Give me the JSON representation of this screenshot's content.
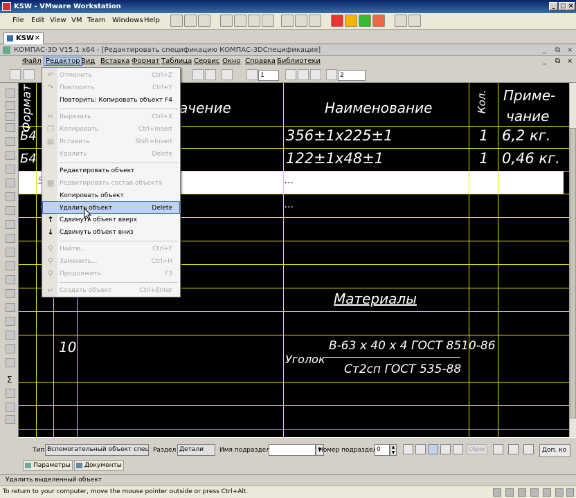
{
  "vm": {
    "title": "KSW - VMware Workstation",
    "menu": [
      "File",
      "Edit",
      "View",
      "VM",
      "Team",
      "Windows",
      "Help"
    ],
    "tab": "KSW",
    "tab_close": "✕",
    "status": "To return to your computer, move the mouse pointer outside or press Ctrl+Alt."
  },
  "kompas": {
    "title": "КОМПАС-3D V15.1 x64 - [Редактировать спецификацию КОМПАС-3DСпецификация]",
    "menu": [
      "Файл",
      "Редактор",
      "Вид",
      "Вставка",
      "Формат",
      "Таблица",
      "Сервис",
      "Окно",
      "Справка",
      "Библиотеки"
    ],
    "toolbar": {
      "step_value": "1",
      "layer_value": "2"
    },
    "status": "Удалить выделенный объект"
  },
  "dropdown": [
    {
      "label": "Отменить",
      "shortcut": "Ctrl+Z",
      "disabled": true,
      "icon": "undo-icon",
      "glyph": "↶"
    },
    {
      "label": "Повторить",
      "shortcut": "Ctrl+Y",
      "disabled": true,
      "icon": "redo-icon",
      "glyph": "↷"
    },
    {
      "label": "Повторить: Копировать объект",
      "shortcut": "F4",
      "disabled": false,
      "icon": "",
      "glyph": ""
    },
    {
      "label": "Вырезать",
      "shortcut": "Ctrl+X",
      "disabled": true,
      "icon": "cut-icon",
      "glyph": "✂"
    },
    {
      "label": "Копировать",
      "shortcut": "Ctrl+Insert",
      "disabled": true,
      "icon": "copy-icon",
      "glyph": "❐"
    },
    {
      "label": "Вставить",
      "shortcut": "Shift+Insert",
      "disabled": true,
      "icon": "paste-icon",
      "glyph": "▤"
    },
    {
      "label": "Удалить",
      "shortcut": "Delete",
      "disabled": true,
      "icon": "",
      "glyph": ""
    },
    {
      "label": "Редактировать объект",
      "shortcut": "",
      "disabled": false,
      "icon": "",
      "glyph": ""
    },
    {
      "label": "Редактировать состав объекта",
      "shortcut": "",
      "disabled": true,
      "icon": "edit-composition-icon",
      "glyph": "▦"
    },
    {
      "label": "Копировать объект",
      "shortcut": "",
      "disabled": false,
      "icon": "",
      "glyph": ""
    },
    {
      "label": "Удалить объект",
      "shortcut": "Delete",
      "disabled": false,
      "highlighted": true,
      "icon": "",
      "glyph": ""
    },
    {
      "label": "Сдвинуть объект вверх",
      "shortcut": "",
      "disabled": false,
      "icon": "arrow-up-icon",
      "glyph": "↑"
    },
    {
      "label": "Сдвинуть объект вниз",
      "shortcut": "",
      "disabled": false,
      "icon": "arrow-down-icon",
      "glyph": "↓"
    },
    {
      "label": "Найти...",
      "shortcut": "Ctrl+F",
      "disabled": true,
      "icon": "find-icon",
      "glyph": "⚲"
    },
    {
      "label": "Заменить...",
      "shortcut": "Ctrl+H",
      "disabled": true,
      "icon": "replace-icon",
      "glyph": "⚲"
    },
    {
      "label": "Продолжить",
      "shortcut": "F3",
      "disabled": true,
      "icon": "continue-icon",
      "glyph": "⚲"
    },
    {
      "label": "Создать объект",
      "shortcut": "Ctrl+Enter",
      "disabled": true,
      "icon": "create-object-icon",
      "glyph": "↵"
    }
  ],
  "spec": {
    "headers": {
      "format": "Формат",
      "designation_partial": "ачение",
      "name": "Наименование",
      "qty": "Кол.",
      "note_line1": "Приме-",
      "note_line2": "чание"
    },
    "rows": [
      {
        "format": "Б4",
        "name": "356±1х225±1",
        "qty": "1",
        "note": "6,2 кг."
      },
      {
        "format": "Б4",
        "name": "122±1х48±1",
        "qty": "1",
        "note": "0,46 кг."
      }
    ],
    "ellipsis1": "...",
    "ellipsis2": "...",
    "section_materials": "Материалы",
    "material": {
      "pos": "10",
      "label": "Уголок",
      "top": "В-63 х 40 х 4 ГОСТ 8510-86",
      "bottom": "Ст2сп ГОСТ 535-88"
    },
    "left_col_glyph": "5"
  },
  "propbar": {
    "type_label": "Тип",
    "type_value": "Вспомогательный объект специфи",
    "section_label": "Раздел",
    "section_value": "Детали",
    "subsection_label": "Имя подраздела",
    "subsection_value": "",
    "subsection_no_label": "Номер подраздела",
    "subsection_no_value": "0",
    "reset_button": "Сброс",
    "extra_button": "Доп. ко"
  },
  "tabs": [
    "Параметры",
    "Документы"
  ]
}
